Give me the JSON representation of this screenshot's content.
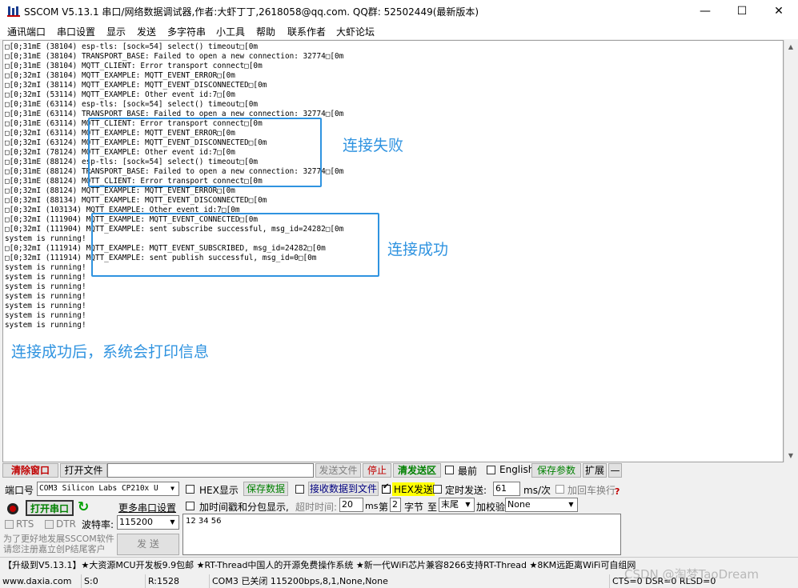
{
  "window": {
    "title": "SSCOM V5.13.1 串口/网络数据调试器,作者:大虾丁丁,2618058@qq.com. QQ群: 52502449(最新版本)",
    "minimize": "—",
    "maximize": "☐",
    "close": "✕"
  },
  "menu": [
    "通讯端口",
    "串口设置",
    "显示",
    "发送",
    "多字符串",
    "小工具",
    "帮助",
    "联系作者",
    "大虾论坛"
  ],
  "log": [
    "□[0;31mE (38104) esp-tls: [sock=54] select() timeout□[0m",
    "□[0;31mE (38104) TRANSPORT_BASE: Failed to open a new connection: 32774□[0m",
    "□[0;31mE (38104) MQTT_CLIENT: Error transport connect□[0m",
    "□[0;32mI (38104) MQTT_EXAMPLE: MQTT_EVENT_ERROR□[0m",
    "□[0;32mI (38114) MQTT_EXAMPLE: MQTT_EVENT_DISCONNECTED□[0m",
    "□[0;32mI (53114) MQTT_EXAMPLE: Other event id:7□[0m",
    "□[0;31mE (63114) esp-tls: [sock=54] select() timeout□[0m",
    "□[0;31mE (63114) TRANSPORT_BASE: Failed to open a new connection: 32774□[0m",
    "□[0;31mE (63114) MQTT_CLIENT: Error transport connect□[0m",
    "□[0;32mI (63114) MQTT_EXAMPLE: MQTT_EVENT_ERROR□[0m",
    "□[0;32mI (63124) MQTT_EXAMPLE: MQTT_EVENT_DISCONNECTED□[0m",
    "□[0;32mI (78124) MQTT_EXAMPLE: Other event id:7□[0m",
    "□[0;31mE (88124) esp-tls: [sock=54] select() timeout□[0m",
    "□[0;31mE (88124) TRANSPORT_BASE: Failed to open a new connection: 32774□[0m",
    "□[0;31mE (88124) MQTT_CLIENT: Error transport connect□[0m",
    "□[0;32mI (88124) MQTT_EXAMPLE: MQTT_EVENT_ERROR□[0m",
    "□[0;32mI (88134) MQTT_EXAMPLE: MQTT_EVENT_DISCONNECTED□[0m",
    "□[0;32mI (103134) MQTT_EXAMPLE: Other event id:7□[0m",
    "□[0;32mI (111904) MQTT_EXAMPLE: MQTT_EVENT_CONNECTED□[0m",
    "□[0;32mI (111904) MQTT_EXAMPLE: sent subscribe successful, msg_id=24282□[0m",
    "system is running!",
    "□[0;32mI (111914) MQTT_EXAMPLE: MQTT_EVENT_SUBSCRIBED, msg_id=24282□[0m",
    "□[0;32mI (111914) MQTT_EXAMPLE: sent publish successful, msg_id=0□[0m",
    "system is running!",
    "system is running!",
    "system is running!",
    "system is running!",
    "system is running!",
    "system is running!",
    "system is running!"
  ],
  "annotations": {
    "fail": "连接失败",
    "success": "连接成功",
    "note": "连接成功后，系统会打印信息"
  },
  "toolbar": {
    "clear_window": "清除窗口",
    "open_file": "打开文件",
    "file_path": "",
    "send_file": "发送文件",
    "stop": "停止",
    "clear_send": "清发送区",
    "top_most": "最前",
    "english": "English",
    "save_params": "保存参数",
    "expand": "扩展",
    "collapse": "—"
  },
  "controls": {
    "port_label": "端口号",
    "port_value": "COM3 Silicon Labs CP210x U",
    "hex_display": "HEX显示",
    "save_data": "保存数据",
    "recv_to_file": "接收数据到文件",
    "hex_send": "HEX发送",
    "timed_send": "定时发送:",
    "timed_value": "61",
    "timed_unit": "ms/次",
    "add_crlf": "加回车换行",
    "open_port": "打开串口",
    "more_settings": "更多串口设置",
    "timestamp": "加时间戳和分包显示,",
    "timeout_label": "超时时间:",
    "timeout_value": "20",
    "timeout_unit": "ms",
    "byte_prefix": "第",
    "byte_index": "2",
    "byte_label": "字节",
    "to_label": "至",
    "end_value": "末尾",
    "checksum_label": "加校验",
    "checksum_value": "None",
    "rts": "RTS",
    "dtr": "DTR",
    "baud_label": "波特率:",
    "baud_value": "115200",
    "send_text": "12 34 56",
    "send_button": "发 送",
    "promo": "为了更好地发展SSCOM软件\n请您注册嘉立创P结尾客户"
  },
  "marquee": "【升级到V5.13.1】★大资源MCU开发板9.9包邮 ★RT-Thread中国人的开源免费操作系统 ★新一代WiFi芯片兼容8266支持RT-Thread ★8KM远距离WiFi可自组网",
  "status": {
    "website": "www.daxia.com",
    "sent": "S:0",
    "received": "R:1528",
    "port_info": "COM3 已关闭  115200bps,8,1,None,None",
    "lines": "CTS=0 DSR=0 RLSD=0"
  },
  "watermark": "CSDN @淘梦TaoDream"
}
